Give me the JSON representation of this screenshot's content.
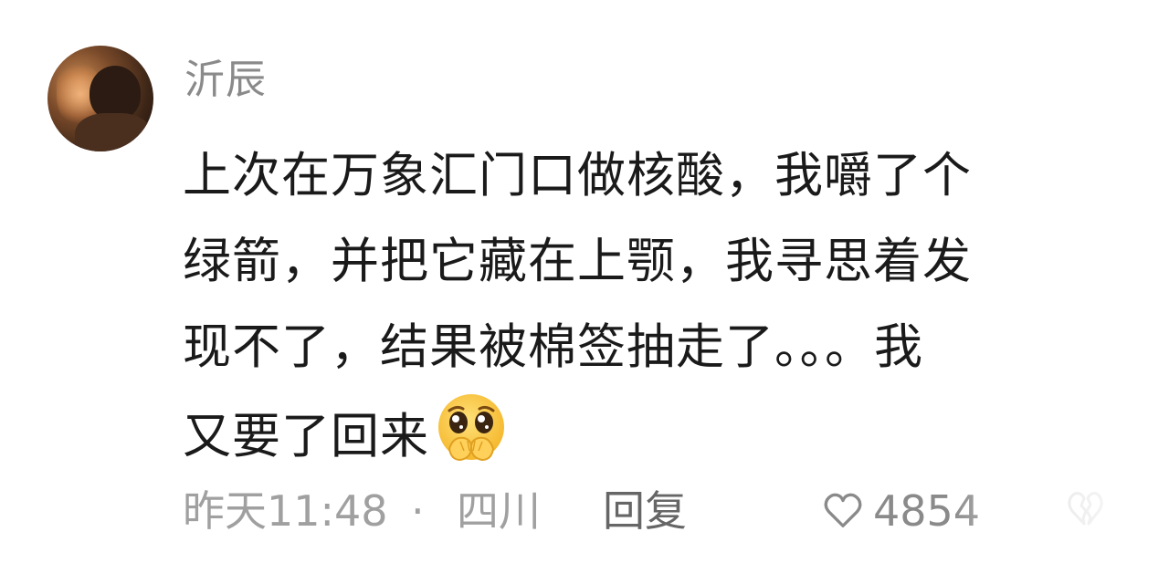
{
  "comment": {
    "username": "沂辰",
    "content_lines": [
      "上次在万象汇门口做核酸，我嚼了个",
      "绿箭，并把它藏在上颚，我寻思着发",
      "现不了，结果被棉签抽走了。。。我",
      "又要了回来"
    ],
    "emoji": "pleading-face-hands-over-mouth",
    "time": "昨天11:48",
    "separator": "·",
    "location": "四川",
    "reply_label": "回复",
    "like_icon": "heart-outline-icon",
    "like_count": "4854",
    "dislike_icon": "broken-heart-icon"
  }
}
